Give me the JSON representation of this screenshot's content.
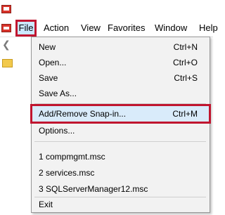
{
  "menubar": {
    "items": [
      {
        "label": "File"
      },
      {
        "label": "Action"
      },
      {
        "label": "View"
      },
      {
        "label": "Favorites"
      },
      {
        "label": "Window"
      },
      {
        "label": "Help"
      }
    ]
  },
  "file_menu": {
    "items": [
      {
        "label": "New",
        "shortcut": "Ctrl+N"
      },
      {
        "label": "Open...",
        "shortcut": "Ctrl+O"
      },
      {
        "label": "Save",
        "shortcut": "Ctrl+S"
      },
      {
        "label": "Save As...",
        "shortcut": ""
      },
      {
        "label": "Add/Remove Snap-in...",
        "shortcut": "Ctrl+M"
      },
      {
        "label": "Options...",
        "shortcut": ""
      },
      {
        "label": "1 compmgmt.msc",
        "shortcut": ""
      },
      {
        "label": "2 services.msc",
        "shortcut": ""
      },
      {
        "label": "3 SQLServerManager12.msc",
        "shortcut": ""
      },
      {
        "label": "Exit",
        "shortcut": ""
      }
    ]
  },
  "colors": {
    "highlight_border": "#c0152f",
    "highlight_fill": "#d9ebfa",
    "menu_background": "#f2f2f2"
  },
  "icons": [
    "mmc-app-icon",
    "back-arrow-icon",
    "folder-icon"
  ]
}
